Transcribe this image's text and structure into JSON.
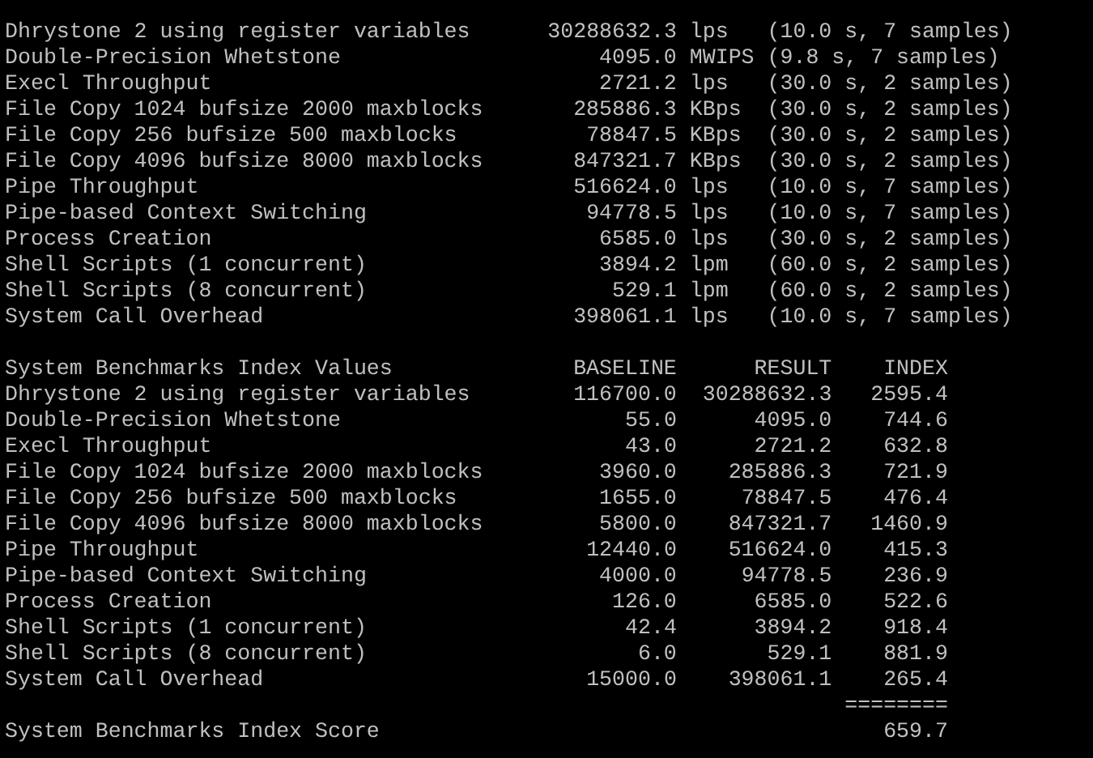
{
  "results": [
    {
      "name": "Dhrystone 2 using register variables",
      "value": "30288632.3",
      "unit": "lps",
      "detail": "(10.0 s, 7 samples)"
    },
    {
      "name": "Double-Precision Whetstone",
      "value": "4095.0",
      "unit": "MWIPS",
      "detail": "(9.8 s, 7 samples)"
    },
    {
      "name": "Execl Throughput",
      "value": "2721.2",
      "unit": "lps",
      "detail": "(30.0 s, 2 samples)"
    },
    {
      "name": "File Copy 1024 bufsize 2000 maxblocks",
      "value": "285886.3",
      "unit": "KBps",
      "detail": "(30.0 s, 2 samples)"
    },
    {
      "name": "File Copy 256 bufsize 500 maxblocks",
      "value": "78847.5",
      "unit": "KBps",
      "detail": "(30.0 s, 2 samples)"
    },
    {
      "name": "File Copy 4096 bufsize 8000 maxblocks",
      "value": "847321.7",
      "unit": "KBps",
      "detail": "(30.0 s, 2 samples)"
    },
    {
      "name": "Pipe Throughput",
      "value": "516624.0",
      "unit": "lps",
      "detail": "(10.0 s, 7 samples)"
    },
    {
      "name": "Pipe-based Context Switching",
      "value": "94778.5",
      "unit": "lps",
      "detail": "(10.0 s, 7 samples)"
    },
    {
      "name": "Process Creation",
      "value": "6585.0",
      "unit": "lps",
      "detail": "(30.0 s, 2 samples)"
    },
    {
      "name": "Shell Scripts (1 concurrent)",
      "value": "3894.2",
      "unit": "lpm",
      "detail": "(60.0 s, 2 samples)"
    },
    {
      "name": "Shell Scripts (8 concurrent)",
      "value": "529.1",
      "unit": "lpm",
      "detail": "(60.0 s, 2 samples)"
    },
    {
      "name": "System Call Overhead",
      "value": "398061.1",
      "unit": "lps",
      "detail": "(10.0 s, 7 samples)"
    }
  ],
  "index": {
    "title": "System Benchmarks Index Values",
    "columns": [
      "BASELINE",
      "RESULT",
      "INDEX"
    ],
    "rows": [
      {
        "name": "Dhrystone 2 using register variables",
        "baseline": "116700.0",
        "result": "30288632.3",
        "index": "2595.4"
      },
      {
        "name": "Double-Precision Whetstone",
        "baseline": "55.0",
        "result": "4095.0",
        "index": "744.6"
      },
      {
        "name": "Execl Throughput",
        "baseline": "43.0",
        "result": "2721.2",
        "index": "632.8"
      },
      {
        "name": "File Copy 1024 bufsize 2000 maxblocks",
        "baseline": "3960.0",
        "result": "285886.3",
        "index": "721.9"
      },
      {
        "name": "File Copy 256 bufsize 500 maxblocks",
        "baseline": "1655.0",
        "result": "78847.5",
        "index": "476.4"
      },
      {
        "name": "File Copy 4096 bufsize 8000 maxblocks",
        "baseline": "5800.0",
        "result": "847321.7",
        "index": "1460.9"
      },
      {
        "name": "Pipe Throughput",
        "baseline": "12440.0",
        "result": "516624.0",
        "index": "415.3"
      },
      {
        "name": "Pipe-based Context Switching",
        "baseline": "4000.0",
        "result": "94778.5",
        "index": "236.9"
      },
      {
        "name": "Process Creation",
        "baseline": "126.0",
        "result": "6585.0",
        "index": "522.6"
      },
      {
        "name": "Shell Scripts (1 concurrent)",
        "baseline": "42.4",
        "result": "3894.2",
        "index": "918.4"
      },
      {
        "name": "Shell Scripts (8 concurrent)",
        "baseline": "6.0",
        "result": "529.1",
        "index": "881.9"
      },
      {
        "name": "System Call Overhead",
        "baseline": "15000.0",
        "result": "398061.1",
        "index": "265.4"
      }
    ],
    "separator": "========",
    "score": {
      "label": "System Benchmarks Index Score",
      "value": "659.7"
    }
  }
}
